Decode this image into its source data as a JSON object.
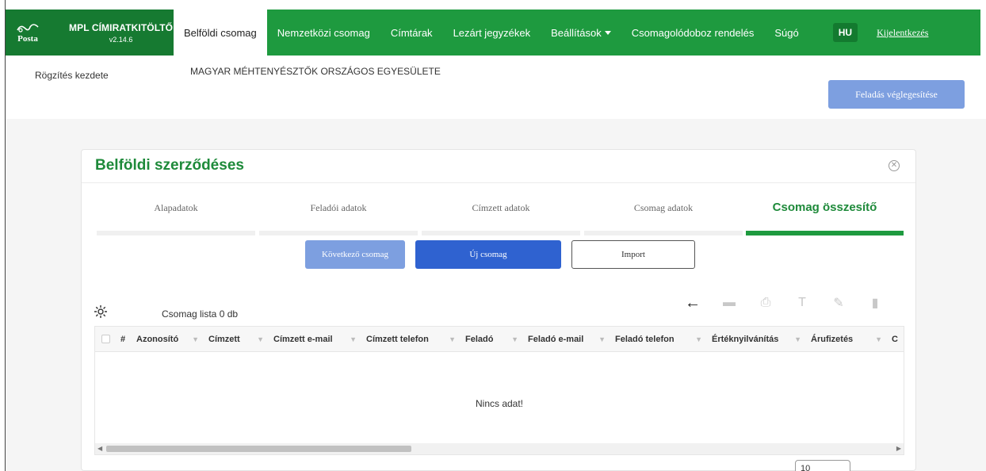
{
  "brand": {
    "logo_text": "Posta",
    "title": "MPL CÍMIRATKITÖLTŐ",
    "version": "v2.14.6"
  },
  "nav": {
    "items": [
      {
        "label": "Belföldi csomag"
      },
      {
        "label": "Nemzetközi csomag"
      },
      {
        "label": "Címtárak"
      },
      {
        "label": "Lezárt jegyzékek"
      },
      {
        "label": "Beállítások"
      },
      {
        "label": "Csomagolódoboz rendelés"
      },
      {
        "label": "Súgó"
      }
    ],
    "language": "HU",
    "logout": "Kijelentkezés"
  },
  "subheader": {
    "start_label": "Rögzítés kezdete",
    "organization": "MAGYAR MÉHTENYÉSZTŐK ORSZÁGOS EGYESÜLETE",
    "finalize_button": "Feladás véglegesítése"
  },
  "card": {
    "title": "Belföldi szerződéses",
    "steps": [
      {
        "label": "Alapadatok"
      },
      {
        "label": "Feladói adatok"
      },
      {
        "label": "Címzett adatok"
      },
      {
        "label": "Csomag adatok"
      },
      {
        "label": "Csomag összesítő"
      }
    ],
    "buttons": {
      "next": "Következő csomag",
      "new": "Új csomag",
      "import": "Import"
    },
    "list_title": "Csomag lista  0 db",
    "table": {
      "columns": [
        "#",
        "Azonosító",
        "Címzett",
        "Címzett e-mail",
        "Címzett telefon",
        "Feladó",
        "Feladó e-mail",
        "Feladó telefon",
        "Értéknyilvánítás",
        "Árufizetés",
        "C"
      ],
      "empty_text": "Nincs adat!"
    },
    "pager": {
      "page_size": "10"
    }
  },
  "colors": {
    "brand_green": "#1e9a3f",
    "accent_blue": "#2f62d0",
    "disabled_blue": "#7d9fe0"
  }
}
